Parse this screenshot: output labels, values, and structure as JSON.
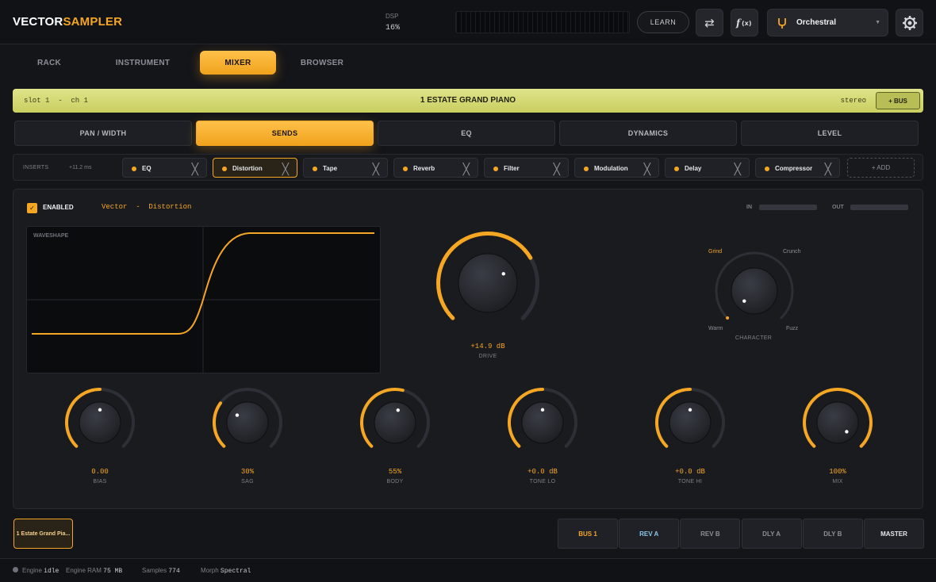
{
  "app": {
    "logo_a": "VECTOR",
    "logo_b": "SAMPLER",
    "dsp_label": "DSP",
    "dsp_value": "16%",
    "learn": "LEARN",
    "preset": "Orchestral"
  },
  "main_tabs": [
    "RACK",
    "INSTRUMENT",
    "MIXER",
    "BROWSER"
  ],
  "channel": {
    "slot": "slot 1  -  ch 1",
    "name": "1 ESTATE GRAND PIANO",
    "mode": "stereo",
    "bus_button": "+ BUS"
  },
  "section_tabs": [
    "PAN / WIDTH",
    "SENDS",
    "EQ",
    "DYNAMICS",
    "LEVEL"
  ],
  "inserts": {
    "label": "INSERTS",
    "latency": "+11.2 ms",
    "slots": [
      "EQ",
      "Distortion",
      "Tape",
      "Reverb",
      "Filter",
      "Modulation",
      "Delay",
      "Compressor"
    ],
    "add": "+ ADD"
  },
  "effect": {
    "enabled_label": "ENABLED",
    "name": "Vector  -  Distortion",
    "in_label": "IN",
    "out_label": "OUT",
    "waveshape_label": "WAVESHAPE",
    "drive": {
      "value": "+14.9 dB",
      "label": "DRIVE",
      "level": 0.72
    },
    "character": {
      "label": "CHARACTER",
      "options": [
        "Grind",
        "Crunch",
        "Warm",
        "Fuzz"
      ],
      "selected": "Grind"
    },
    "knobs": [
      {
        "value": "0.00",
        "label": "BIAS",
        "level": 0.5
      },
      {
        "value": "30%",
        "label": "SAG",
        "level": 0.3
      },
      {
        "value": "55%",
        "label": "BODY",
        "level": 0.55
      },
      {
        "value": "+0.0 dB",
        "label": "TONE LO",
        "level": 0.5
      },
      {
        "value": "+0.0 dB",
        "label": "TONE HI",
        "level": 0.5
      },
      {
        "value": "100%",
        "label": "MIX",
        "level": 1.0
      }
    ]
  },
  "track_chip": "1 Estate Grand Pia...",
  "buses": [
    "BUS 1",
    "REV A",
    "REV B",
    "DLY A",
    "DLY B",
    "MASTER"
  ],
  "status": {
    "engine_label": "Engine",
    "engine_value": "idle",
    "ram_label": "Engine RAM",
    "ram_value": "75 MB",
    "samples_label": "Samples",
    "samples_value": "774",
    "morph_label": "Morph",
    "morph_value": "Spectral"
  },
  "colors": {
    "accent": "#f5a623",
    "channel": "#d6db75",
    "rev_a": "#8fc6e8"
  }
}
